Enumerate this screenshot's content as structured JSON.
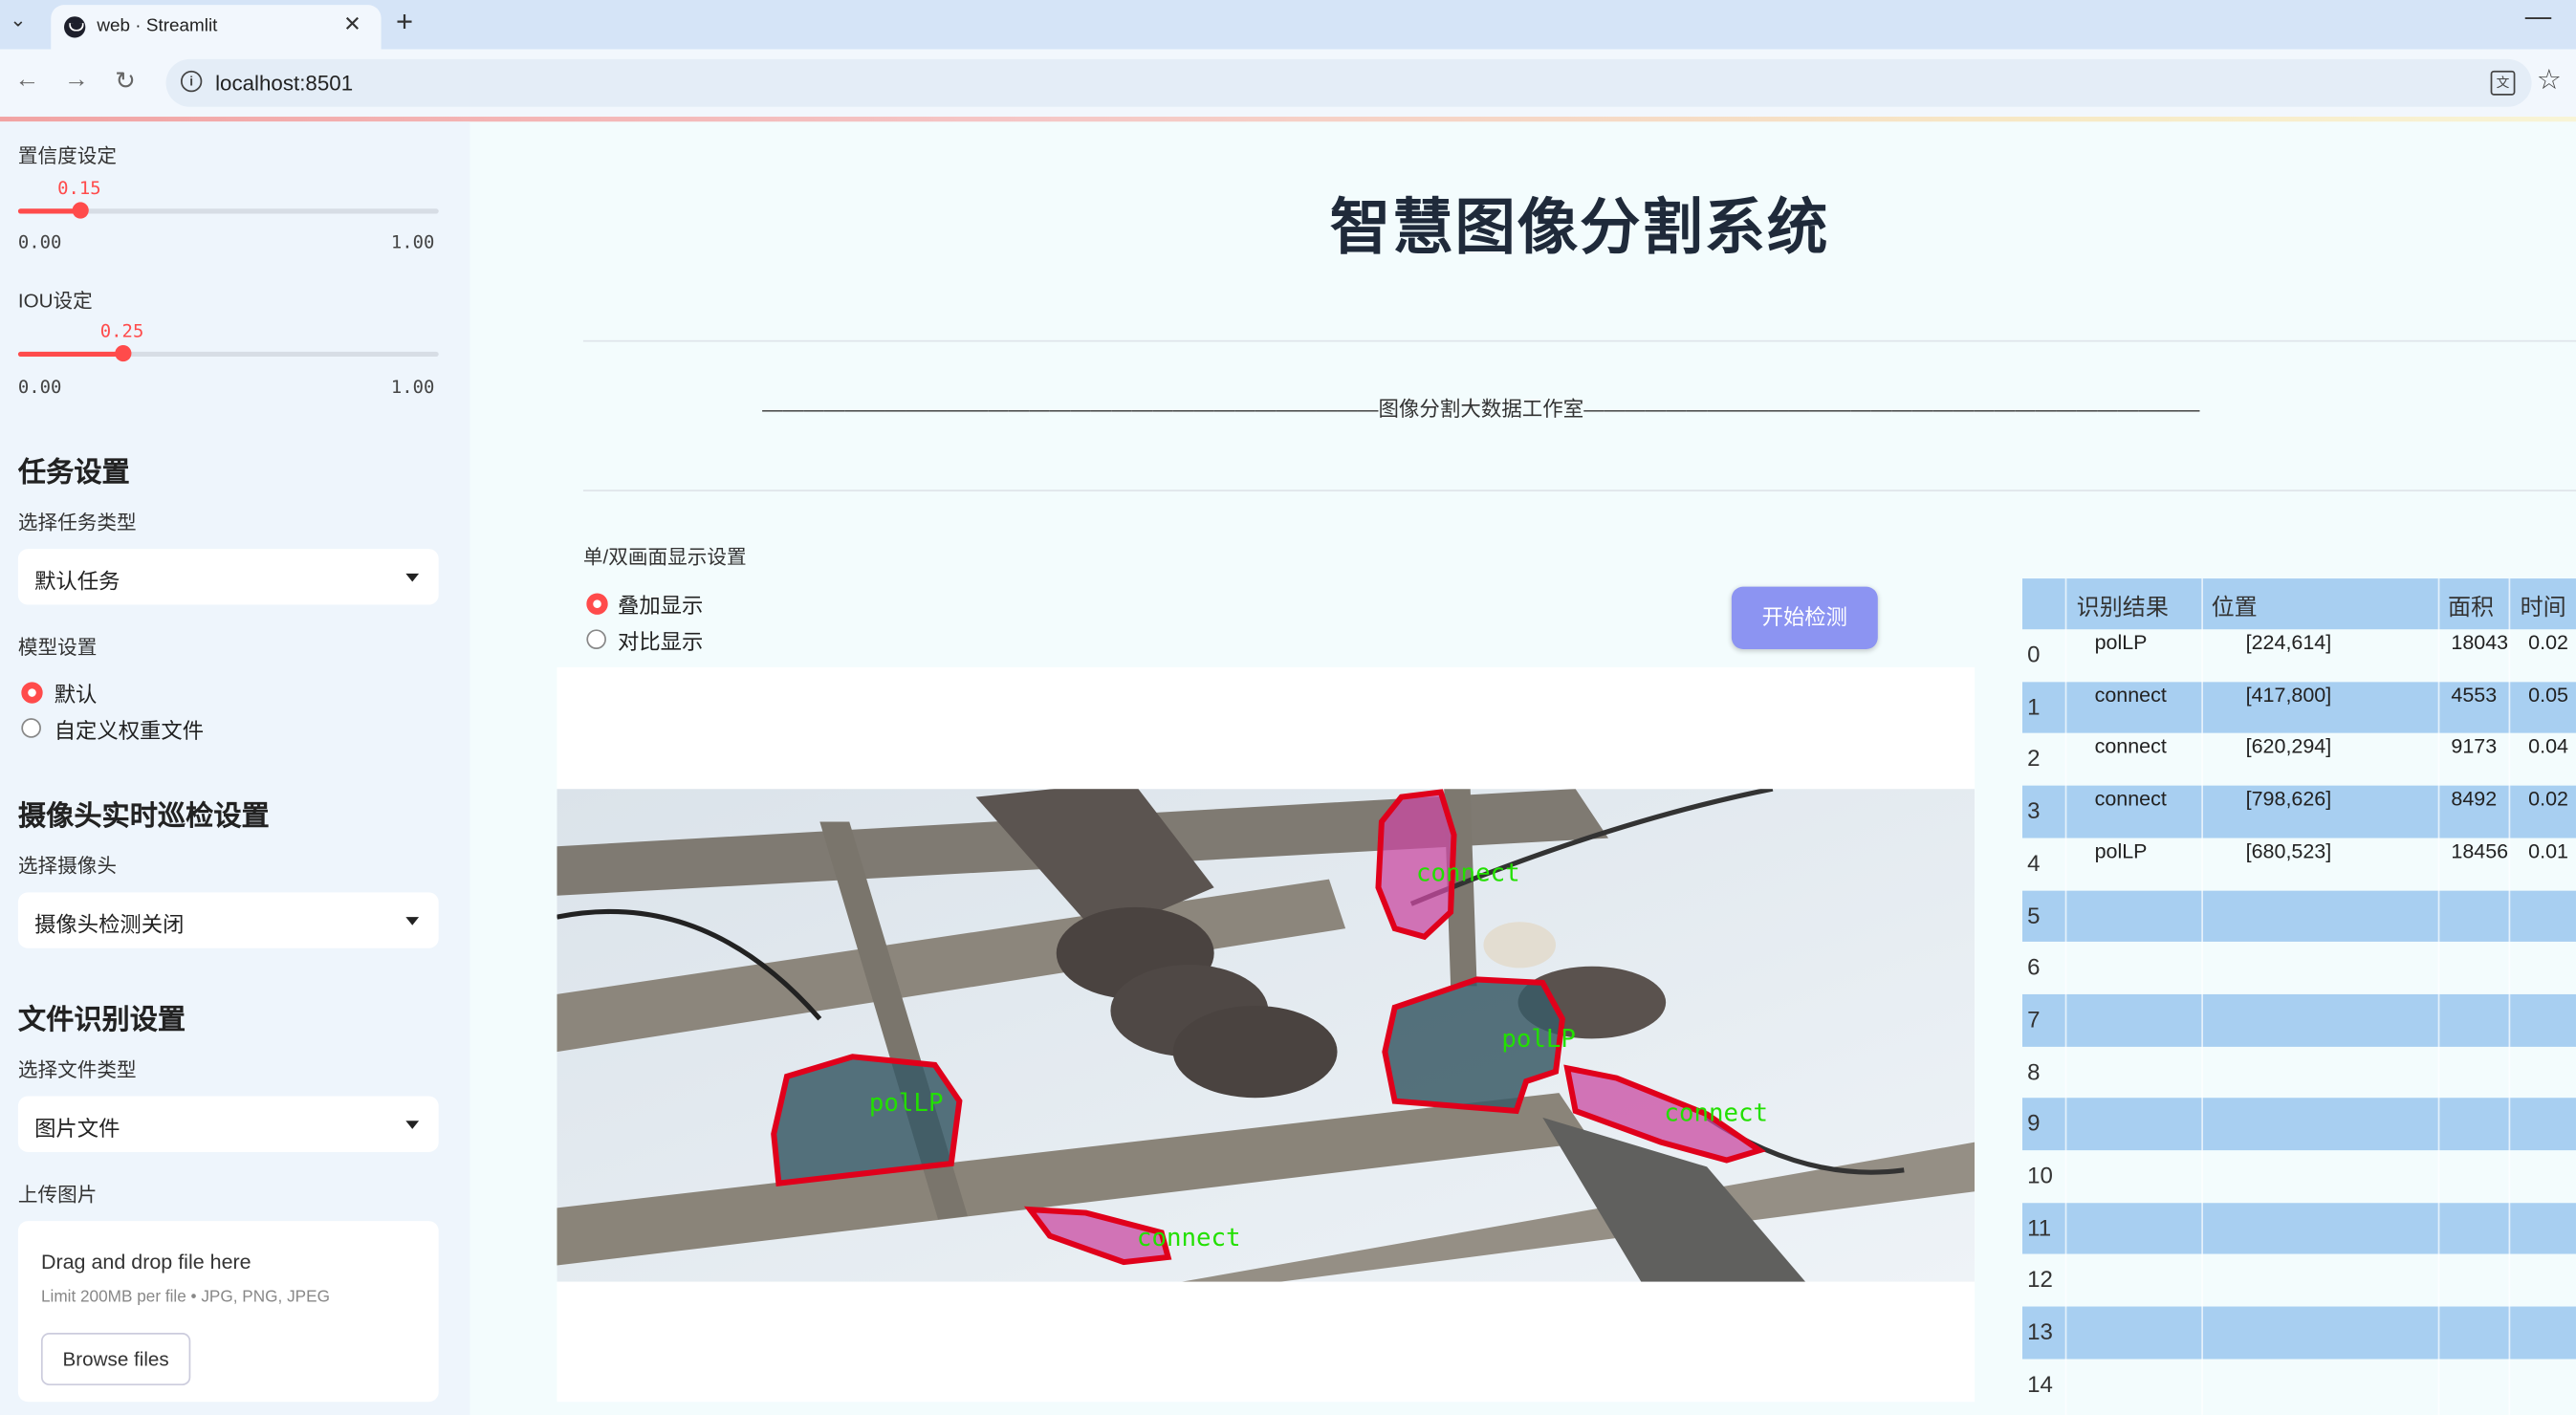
{
  "browser": {
    "tab_title": "web · Streamlit",
    "url": "localhost:8501"
  },
  "sidebar": {
    "confidence": {
      "label": "置信度设定",
      "value_label": "0.15",
      "value": 0.15,
      "min": "0.00",
      "max": "1.00"
    },
    "iou": {
      "label": "IOU设定",
      "value_label": "0.25",
      "value": 0.25,
      "min": "0.00",
      "max": "1.00"
    },
    "task_section": "任务设置",
    "task_type_label": "选择任务类型",
    "task_type_value": "默认任务",
    "model_label": "模型设置",
    "model_options": [
      "默认",
      "自定义权重文件"
    ],
    "camera_section": "摄像头实时巡检设置",
    "camera_label": "选择摄像头",
    "camera_value": "摄像头检测关闭",
    "file_section": "文件识别设置",
    "file_type_label": "选择文件类型",
    "file_type_value": "图片文件",
    "upload_label": "上传图片",
    "upload_title": "Drag and drop file here",
    "upload_limit": "Limit 200MB per file • JPG, PNG, JPEG",
    "browse_label": "Browse files"
  },
  "main": {
    "title": "智慧图像分割系统",
    "divider": "——————————————————————————————图像分割大数据工作室——————————————————————————————",
    "display_label": "单/双画面显示设置",
    "display_options": [
      "叠加显示",
      "对比显示"
    ],
    "start_button": "开始检测",
    "detections": [
      {
        "label": "connect"
      },
      {
        "label": "polLP"
      },
      {
        "label": "polLP"
      },
      {
        "label": "connect"
      },
      {
        "label": "connect"
      }
    ]
  },
  "table": {
    "headers": [
      "识别结果",
      "位置",
      "面积",
      "时间"
    ],
    "rows": [
      {
        "idx": "0",
        "result": "polLP",
        "pos": "[224,614]",
        "area": "18043",
        "time": "0.02"
      },
      {
        "idx": "1",
        "result": "connect",
        "pos": "[417,800]",
        "area": "4553",
        "time": "0.05"
      },
      {
        "idx": "2",
        "result": "connect",
        "pos": "[620,294]",
        "area": "9173",
        "time": "0.04"
      },
      {
        "idx": "3",
        "result": "connect",
        "pos": "[798,626]",
        "area": "8492",
        "time": "0.02"
      },
      {
        "idx": "4",
        "result": "polLP",
        "pos": "[680,523]",
        "area": "18456",
        "time": "0.01"
      },
      {
        "idx": "5",
        "result": "",
        "pos": "",
        "area": "",
        "time": ""
      },
      {
        "idx": "6",
        "result": "",
        "pos": "",
        "area": "",
        "time": ""
      },
      {
        "idx": "7",
        "result": "",
        "pos": "",
        "area": "",
        "time": ""
      },
      {
        "idx": "8",
        "result": "",
        "pos": "",
        "area": "",
        "time": ""
      },
      {
        "idx": "9",
        "result": "",
        "pos": "",
        "area": "",
        "time": ""
      },
      {
        "idx": "10",
        "result": "",
        "pos": "",
        "area": "",
        "time": ""
      },
      {
        "idx": "11",
        "result": "",
        "pos": "",
        "area": "",
        "time": ""
      },
      {
        "idx": "12",
        "result": "",
        "pos": "",
        "area": "",
        "time": ""
      },
      {
        "idx": "13",
        "result": "",
        "pos": "",
        "area": "",
        "time": ""
      },
      {
        "idx": "14",
        "result": "",
        "pos": "",
        "area": "",
        "time": ""
      }
    ]
  },
  "colors": {
    "accent": "#ff4b4b",
    "button": "#8c94f2",
    "table_stripe": "#a8cff1",
    "mask_outline": "#e0001b",
    "label_text": "#22e000"
  }
}
